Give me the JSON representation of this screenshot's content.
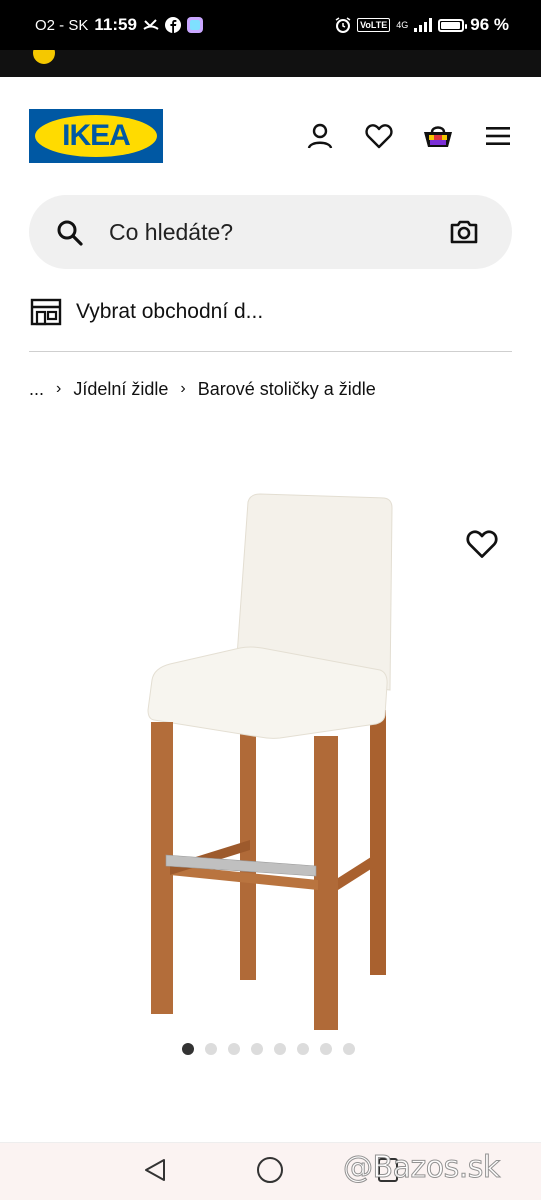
{
  "status_bar": {
    "carrier": "O2 - SK",
    "time": "11:59",
    "volte": "VoLTE",
    "network": "4G",
    "battery_percent": "96 %",
    "battery_level": 0.96
  },
  "header": {
    "logo_text": "IKEA",
    "icons": [
      "account-icon",
      "heart-icon",
      "cart-icon",
      "menu-icon"
    ]
  },
  "search": {
    "placeholder": "Co hledáte?"
  },
  "store": {
    "label": "Vybrat obchodní d..."
  },
  "breadcrumb": {
    "ellipsis": "...",
    "items": [
      "Jídelní židle",
      "Barové stoličky a židle"
    ]
  },
  "gallery": {
    "dot_count": 8,
    "active_index": 0
  },
  "watermark": "@Bazos.sk",
  "colors": {
    "ikea_blue": "#0058a3",
    "ikea_yellow": "#ffdb00",
    "search_bg": "#f0f0f0"
  }
}
